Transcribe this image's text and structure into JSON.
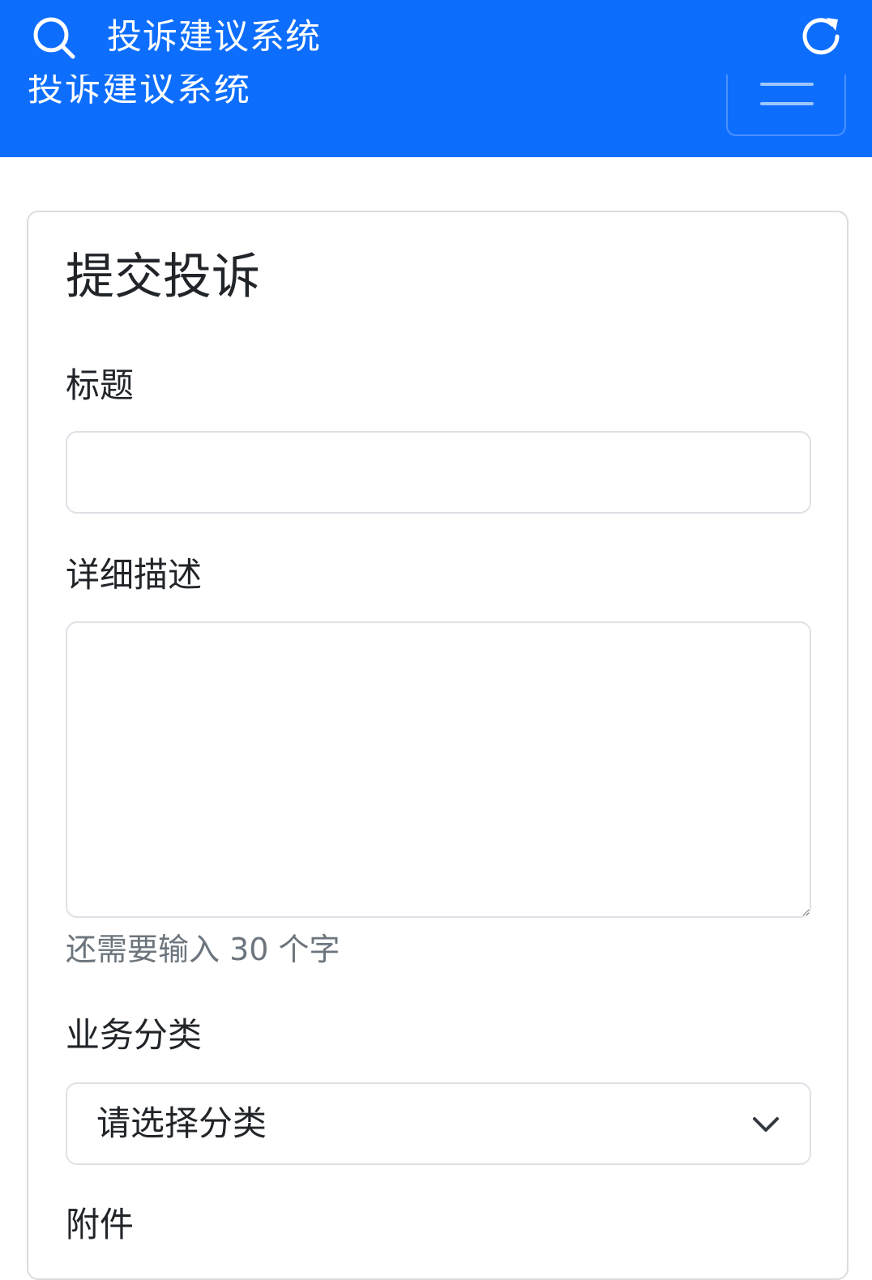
{
  "header": {
    "app_title": "投诉建议系统",
    "brand": "投诉建议系统",
    "icons": {
      "search": "search-icon",
      "refresh": "refresh-icon",
      "menu": "menu-icon"
    },
    "background_color": "#0d6efd"
  },
  "form": {
    "card_title": "提交投诉",
    "title_label": "标题",
    "title_value": "",
    "description_label": "详细描述",
    "description_value": "",
    "description_hint": "还需要输入 30 个字",
    "category_label": "业务分类",
    "category_selected": "请选择分类",
    "attachment_label": "附件"
  }
}
